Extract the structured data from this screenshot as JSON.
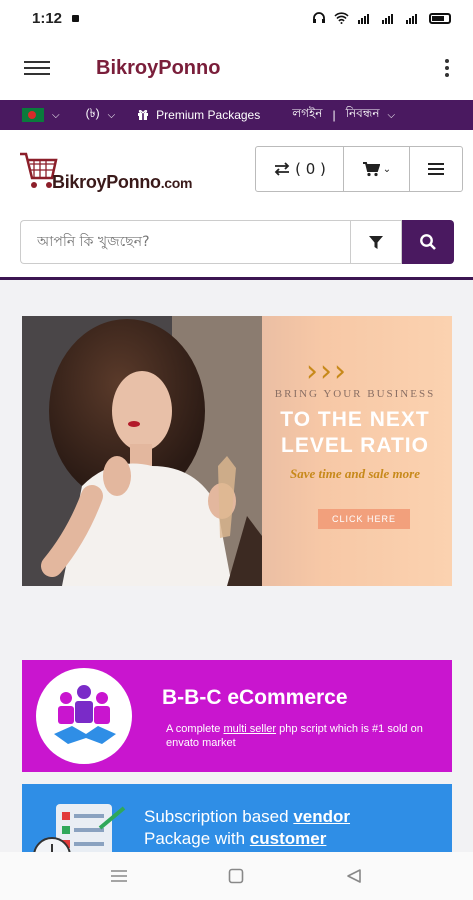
{
  "status_bar": {
    "time": "1:12",
    "right_icons": [
      "headset-icon",
      "wifi-icon",
      "signal-icon",
      "signal-icon",
      "signal-icon",
      "battery-icon"
    ]
  },
  "app_bar": {
    "title": "BikroyPonno",
    "icons": {
      "menu": "hamburger-icon",
      "more": "more-vert-icon"
    }
  },
  "top_bar": {
    "language_flag": "bangladesh-flag",
    "currency": "(৳)",
    "premium": "Premium Packages",
    "login": "লগইন",
    "separator": "|",
    "register": "নিবন্ধন"
  },
  "header": {
    "logo_main": "BikroyPonno",
    "logo_suffix": ".com",
    "compare_count": "( 0 )",
    "icons": {
      "compare": "compare-arrows-icon",
      "cart": "cart-icon",
      "menu": "hamburger-icon"
    }
  },
  "search": {
    "placeholder": "আপনি কি খুজছেন?",
    "icons": {
      "filter": "filter-icon",
      "search": "search-icon"
    }
  },
  "hero_banner": {
    "line1": "BRING YOUR BUSINESS",
    "line2": "TO THE NEXT",
    "line3": "LEVEL RATIO",
    "tagline": "Save time and sale more",
    "cta": "CLICK HERE"
  },
  "promo_bbc": {
    "title": "B-B-C eCommerce",
    "desc_prefix": "A complete ",
    "desc_link": "multi seller",
    "desc_suffix": " php script which is #1  sold on envato market"
  },
  "promo_subscription": {
    "line1_prefix": "Subscription based ",
    "line1_link": "vendor",
    "line2_prefix": "Package with ",
    "line2_link": "customer"
  },
  "nav_bar": {
    "icons": [
      "recents-icon",
      "home-icon",
      "back-icon"
    ]
  },
  "colors": {
    "brand_purple": "#4a1960",
    "title_maroon": "#7a1e3a",
    "promo_magenta": "#c915cf",
    "promo_blue": "#2f8ee6",
    "accent_gold": "#c7891a"
  }
}
